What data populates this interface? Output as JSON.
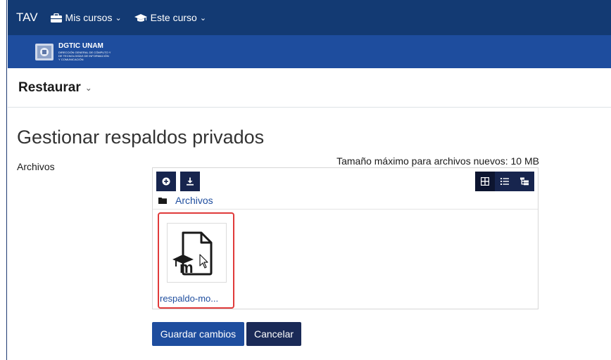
{
  "nav": {
    "brand": "TAV",
    "my_courses": "Mis cursos",
    "this_course": "Este curso"
  },
  "banner": {
    "logo_title": "DGTIC UNAM",
    "logo_sub_1": "DIRECCIÓN GENERAL DE CÓMPUTO Y",
    "logo_sub_2": "DE TECNOLOGÍAS DE INFORMACIÓN",
    "logo_sub_3": "Y COMUNICACIÓN"
  },
  "page": {
    "header_title": "Restaurar",
    "heading": "Gestionar respaldos privados",
    "files_label": "Archivos",
    "max_size": "Tamaño máximo para archivos nuevos: 10 MB"
  },
  "filemanager": {
    "path_label": "Archivos",
    "file_name": "respaldo-mo...",
    "toolbar_icons": [
      "add-file-icon",
      "download-icon"
    ],
    "view_icons": [
      "grid-view-icon",
      "list-view-icon",
      "tree-view-icon"
    ]
  },
  "actions": {
    "save_label": "Guardar cambios",
    "cancel_label": "Cancelar"
  },
  "colors": {
    "nav_bg": "#133a73",
    "banner_bg": "#1e4d9e",
    "primary": "#1e4d9e",
    "dark_button": "#17254e",
    "highlight": "#e03a3a"
  }
}
